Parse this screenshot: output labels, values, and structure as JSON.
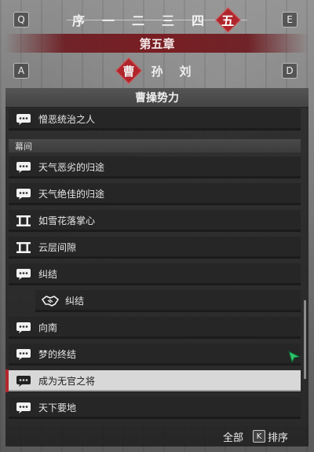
{
  "keys": {
    "q": "Q",
    "e": "E",
    "a": "A",
    "d": "D"
  },
  "chapter_tabs": [
    "序",
    "一",
    "二",
    "三",
    "四",
    "五"
  ],
  "active_chapter_index": 5,
  "chapter_title": "第五章",
  "faction_tabs": [
    "曹",
    "孙",
    "刘"
  ],
  "active_faction_index": 0,
  "panel_title": "曹操势力",
  "entries_top": [
    {
      "icon": "speech-bubble-icon",
      "label": "憎恶统治之人"
    }
  ],
  "section_label": "幕间",
  "entries": [
    {
      "icon": "speech-bubble-icon",
      "label": "天气恶劣的归途"
    },
    {
      "icon": "speech-bubble-icon",
      "label": "天气绝佳的归途"
    },
    {
      "icon": "film-strip-icon",
      "label": "如雪花落掌心"
    },
    {
      "icon": "film-strip-icon",
      "label": "云层间隙"
    },
    {
      "icon": "speech-bubble-icon",
      "label": "纠结"
    },
    {
      "icon": "handshake-icon",
      "label": "纠结",
      "sub": true
    },
    {
      "icon": "speech-bubble-icon",
      "label": "向南"
    },
    {
      "icon": "speech-bubble-icon",
      "label": "梦的终结"
    },
    {
      "icon": "speech-bubble-icon",
      "label": "成为无官之将",
      "selected": true
    },
    {
      "icon": "speech-bubble-icon",
      "label": "天下要地"
    }
  ],
  "footer": {
    "filter_label": "全部",
    "sort_key": "K",
    "sort_label": "排序"
  },
  "colors": {
    "accent_red": "#b0262c",
    "panel_bg": "#262626",
    "selected_bg": "#d8d8d8",
    "cursor_green": "#2fc46b"
  }
}
